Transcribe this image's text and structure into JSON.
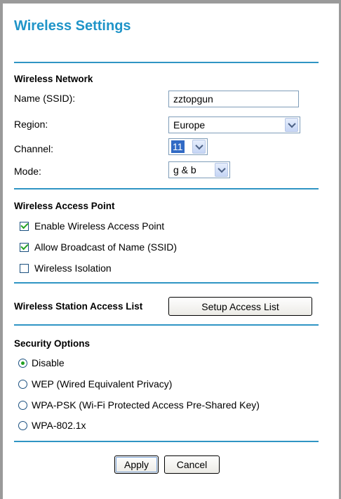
{
  "page": {
    "title": "Wireless Settings"
  },
  "wireless_network": {
    "heading": "Wireless Network",
    "name_label": "Name (SSID):",
    "name_value": "zztopgun",
    "region_label": "Region:",
    "region_value": "Europe",
    "channel_label": "Channel:",
    "channel_value": "11",
    "mode_label": "Mode:",
    "mode_value": "g & b"
  },
  "access_point": {
    "heading": "Wireless Access Point",
    "options": [
      {
        "label": "Enable Wireless Access Point",
        "checked": true
      },
      {
        "label": "Allow Broadcast of Name (SSID)",
        "checked": true
      },
      {
        "label": "Wireless Isolation",
        "checked": false
      }
    ]
  },
  "station_list": {
    "heading": "Wireless Station Access List",
    "button_label": "Setup Access List"
  },
  "security": {
    "heading": "Security Options",
    "selected": "Disable",
    "options": [
      {
        "label": "Disable"
      },
      {
        "label": "WEP (Wired Equivalent Privacy)"
      },
      {
        "label": "WPA-PSK (Wi-Fi Protected Access Pre-Shared Key)"
      },
      {
        "label": "WPA-802.1x"
      }
    ]
  },
  "actions": {
    "apply_label": "Apply",
    "cancel_label": "Cancel"
  }
}
